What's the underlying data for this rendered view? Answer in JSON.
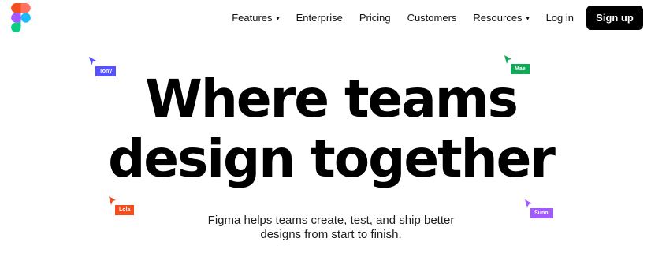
{
  "brand": {
    "logo_icon": "figma-logo-icon"
  },
  "nav": {
    "items": [
      {
        "label": "Features",
        "has_caret": true
      },
      {
        "label": "Enterprise",
        "has_caret": false
      },
      {
        "label": "Pricing",
        "has_caret": false
      },
      {
        "label": "Customers",
        "has_caret": false
      },
      {
        "label": "Resources",
        "has_caret": true
      }
    ],
    "caret_glyph": "▾",
    "login_label": "Log in",
    "signup_label": "Sign up"
  },
  "hero": {
    "headline_line1": "Where teams",
    "headline_line2": "design together",
    "subtitle_line1": "Figma helps teams create, test, and ship better",
    "subtitle_line2": "designs from start to finish."
  },
  "cursors": [
    {
      "name": "Tony",
      "color": "#5551ff"
    },
    {
      "name": "Mae",
      "color": "#0fa958"
    },
    {
      "name": "Lola",
      "color": "#f24e1e"
    },
    {
      "name": "Sunni",
      "color": "#a259ff"
    }
  ],
  "colors": {
    "figma_red": "#f24e1e",
    "figma_orange": "#ff7262",
    "figma_purple": "#a259ff",
    "figma_blue": "#1abcfe",
    "figma_green": "#0acf83",
    "signup_bg": "#000000"
  }
}
